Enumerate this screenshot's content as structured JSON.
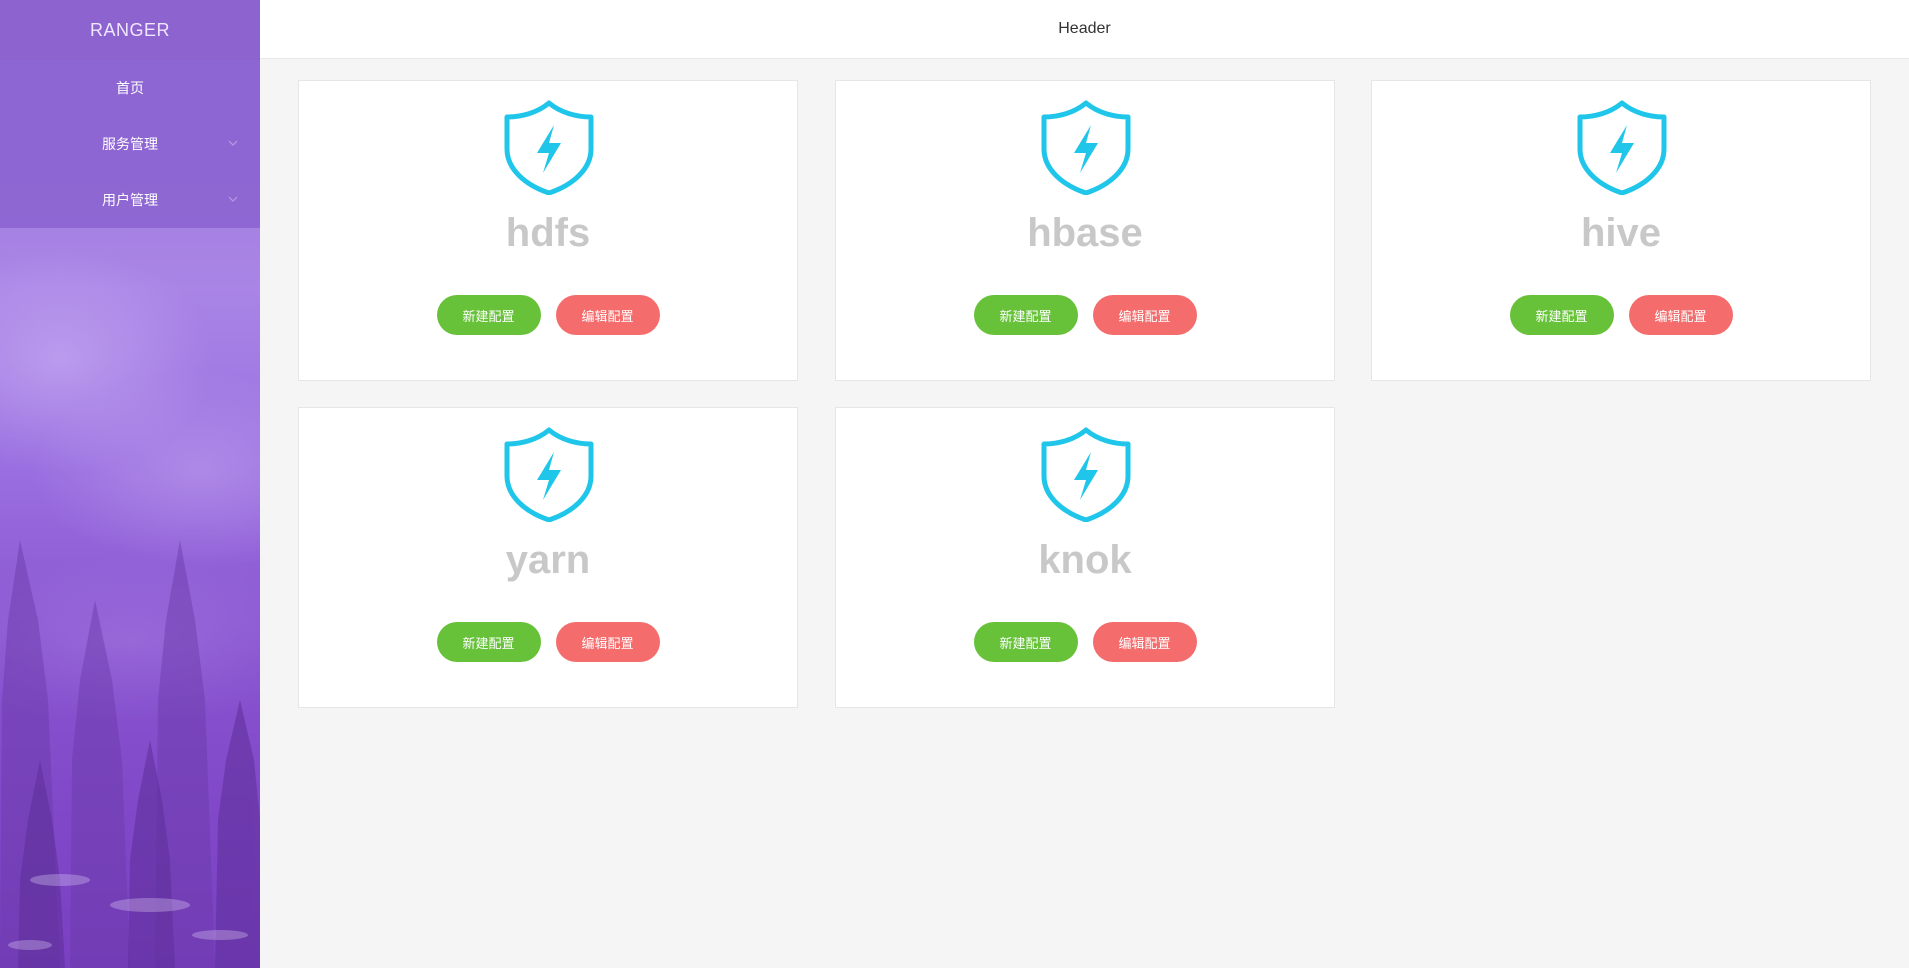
{
  "app": {
    "logo": "RANGER"
  },
  "sidebar": {
    "items": [
      {
        "label": "首页",
        "has_submenu": false
      },
      {
        "label": "服务管理",
        "has_submenu": true
      },
      {
        "label": "用户管理",
        "has_submenu": true
      }
    ]
  },
  "header": {
    "title": "Header"
  },
  "services": [
    {
      "name": "hdfs",
      "new_label": "新建配置",
      "edit_label": "编辑配置"
    },
    {
      "name": "hbase",
      "new_label": "新建配置",
      "edit_label": "编辑配置"
    },
    {
      "name": "hive",
      "new_label": "新建配置",
      "edit_label": "编辑配置"
    },
    {
      "name": "yarn",
      "new_label": "新建配置",
      "edit_label": "编辑配置"
    },
    {
      "name": "knok",
      "new_label": "新建配置",
      "edit_label": "编辑配置"
    }
  ],
  "icons": {
    "service_icon": "shield-lightning-icon",
    "submenu_icon": "chevron-down-icon"
  },
  "colors": {
    "sidebar": "#8d63cf",
    "shield": "#1fc6ea",
    "new_button": "#67c23a",
    "edit_button": "#f56c6c",
    "service_name": "#c8c8c8"
  }
}
